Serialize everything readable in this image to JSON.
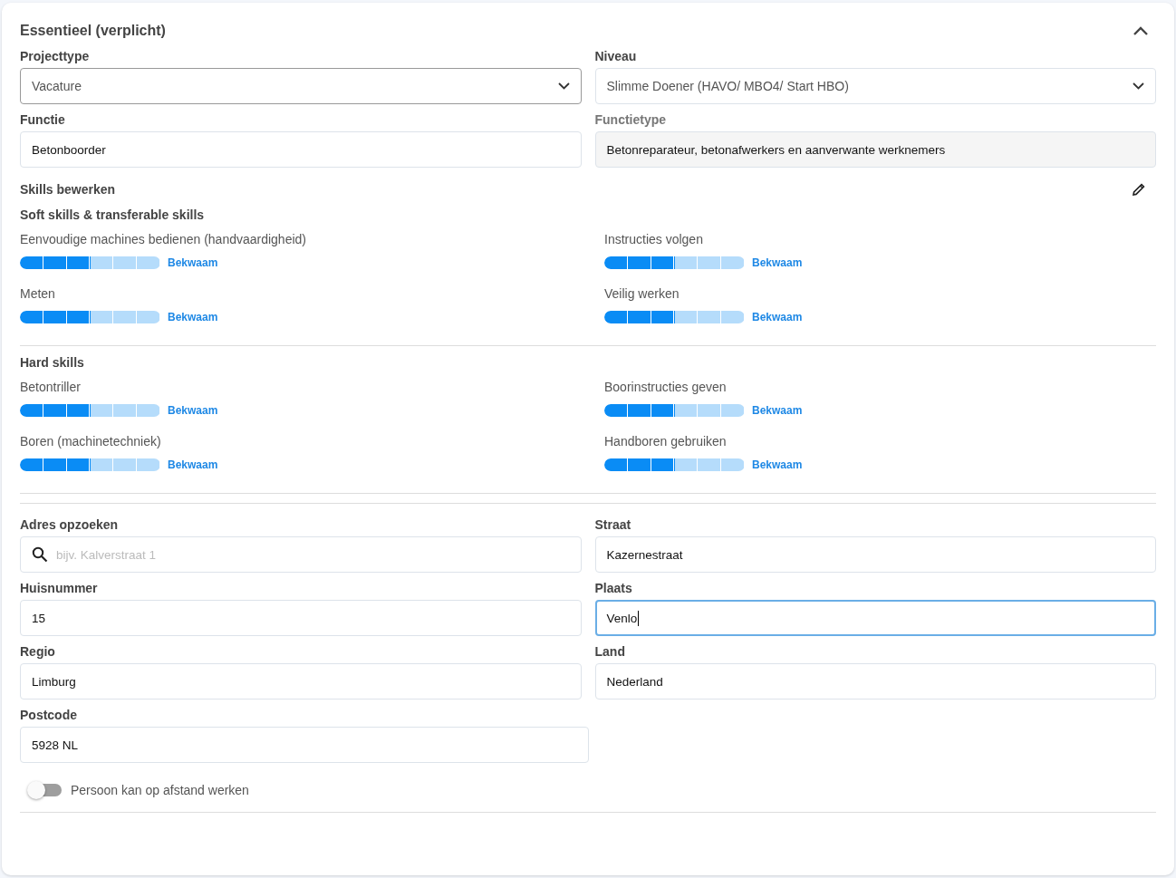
{
  "section": {
    "title": "Essentieel (verplicht)",
    "expanded": true
  },
  "top_fields": [
    {
      "label": "Projecttype",
      "kind": "select",
      "value": "Vacature"
    },
    {
      "label": "Niveau",
      "kind": "select",
      "value": "Slimme Doener (HAVO/ MBO4/ Start HBO)"
    },
    {
      "label": "Functie",
      "kind": "text",
      "value": "Betonboorder"
    },
    {
      "label": "Functietype",
      "kind": "readonly",
      "value": "Betonreparateur, betonafwerkers en aanverwante werknemers"
    }
  ],
  "skills": {
    "title": "Skills bewerken",
    "groups": [
      {
        "title": "Soft skills & transferable skills",
        "items": [
          {
            "name": "Eenvoudige machines bedienen (handvaardigheid)",
            "level": 0.5,
            "reading": "Bekwaam"
          },
          {
            "name": "Instructies volgen",
            "level": 0.5,
            "reading": "Bekwaam"
          },
          {
            "name": "Meten",
            "level": 0.5,
            "reading": "Bekwaam"
          },
          {
            "name": "Veilig werken",
            "level": 0.5,
            "reading": "Bekwaam"
          }
        ]
      },
      {
        "title": "Hard skills",
        "items": [
          {
            "name": "Betontriller",
            "level": 0.5,
            "reading": "Bekwaam"
          },
          {
            "name": "Boorinstructies geven",
            "level": 0.5,
            "reading": "Bekwaam"
          },
          {
            "name": "Boren (machinetechniek)",
            "level": 0.5,
            "reading": "Bekwaam"
          },
          {
            "name": "Handboren gebruiken",
            "level": 0.5,
            "reading": "Bekwaam"
          }
        ]
      }
    ]
  },
  "address_fields": [
    {
      "label": "Adres opzoeken",
      "kind": "search",
      "placeholder": "bijv. Kalverstraat 1",
      "focused": false
    },
    {
      "label": "Straat",
      "kind": "text",
      "value": "Kazernestraat",
      "focused": false
    },
    {
      "label": "Huisnummer",
      "kind": "text",
      "value": "15",
      "focused": false
    },
    {
      "label": "Plaats",
      "kind": "text",
      "value": "Venlo",
      "focused": true
    },
    {
      "label": "Regio",
      "kind": "text",
      "value": "Limburg",
      "focused": false
    },
    {
      "label": "Land",
      "kind": "text",
      "value": "Nederland",
      "focused": false
    },
    {
      "label": "Postcode",
      "kind": "text",
      "value": "5928 NL",
      "focused": false
    }
  ],
  "remote_toggle": {
    "label": "Persoon kan op afstand werken",
    "on": false
  }
}
